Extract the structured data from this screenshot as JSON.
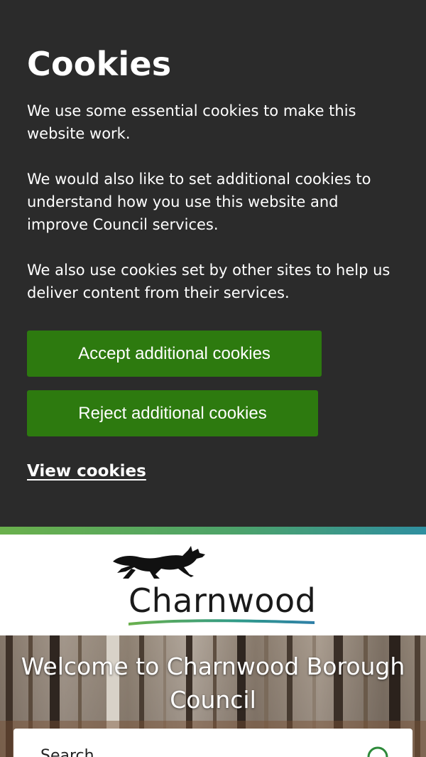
{
  "cookies": {
    "title": "Cookies",
    "paragraphs": [
      "We use some essential cookies to make this website work.",
      "We would also like to set additional cookies to understand how you use this website and improve Council services.",
      "We also use cookies set by other sites to help us deliver content from their services."
    ],
    "accept_label": "Accept additional cookies",
    "reject_label": "Reject additional cookies",
    "view_label": "View cookies"
  },
  "header": {
    "logo_text": "Charnwood"
  },
  "hero": {
    "title": "Welcome to Charnwood Borough Council"
  },
  "search": {
    "placeholder": "Search"
  },
  "colors": {
    "banner_bg": "#2b2b2b",
    "button_green": "#2d7a0f",
    "accent_green": "#6ab04c",
    "accent_teal": "#2f8fa0"
  }
}
